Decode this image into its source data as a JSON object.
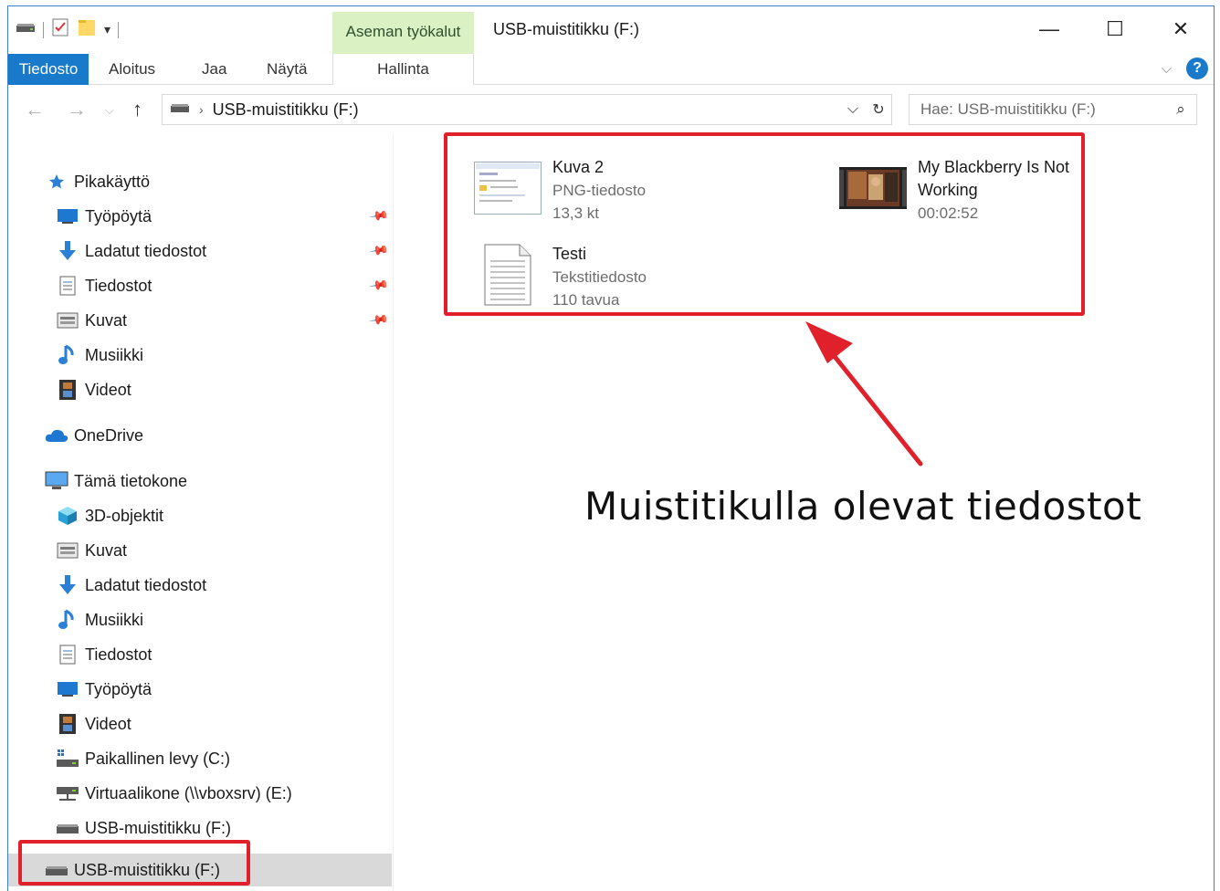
{
  "window": {
    "title": "USB-muistitikku (F:)",
    "context_tab_group": "Aseman työkalut",
    "caption_buttons": {
      "minimize": "—",
      "maximize": "☐",
      "close": "✕"
    }
  },
  "ribbon": {
    "tabs": [
      {
        "label": "Tiedosto"
      },
      {
        "label": "Aloitus"
      },
      {
        "label": "Jaa"
      },
      {
        "label": "Näytä"
      },
      {
        "label": "Hallinta"
      }
    ],
    "help_label": "?",
    "expand_icon": "chevron-down-icon"
  },
  "address": {
    "path": "USB-muistitikku (F:)",
    "search_placeholder": "Hae: USB-muistitikku (F:)"
  },
  "nav": {
    "quick_access": {
      "label": "Pikakäyttö",
      "items": [
        {
          "label": "Työpöytä",
          "icon": "desktop-icon",
          "pinned": true
        },
        {
          "label": "Ladatut tiedostot",
          "icon": "download-icon",
          "pinned": true
        },
        {
          "label": "Tiedostot",
          "icon": "documents-icon",
          "pinned": true
        },
        {
          "label": "Kuvat",
          "icon": "pictures-icon",
          "pinned": true
        },
        {
          "label": "Musiikki",
          "icon": "music-icon",
          "pinned": false
        },
        {
          "label": "Videot",
          "icon": "videos-icon",
          "pinned": false
        }
      ]
    },
    "onedrive": {
      "label": "OneDrive"
    },
    "this_pc": {
      "label": "Tämä tietokone",
      "items": [
        {
          "label": "3D-objektit",
          "icon": "3d-objects-icon"
        },
        {
          "label": "Kuvat",
          "icon": "pictures-icon"
        },
        {
          "label": "Ladatut tiedostot",
          "icon": "download-icon"
        },
        {
          "label": "Musiikki",
          "icon": "music-icon"
        },
        {
          "label": "Tiedostot",
          "icon": "documents-icon"
        },
        {
          "label": "Työpöytä",
          "icon": "desktop-icon"
        },
        {
          "label": "Videot",
          "icon": "videos-icon"
        },
        {
          "label": "Paikallinen levy (C:)",
          "icon": "local-disk-icon"
        },
        {
          "label": "Virtuaalikone (\\\\vboxsrv) (E:)",
          "icon": "network-drive-icon"
        },
        {
          "label": "USB-muistitikku (F:)",
          "icon": "usb-drive-icon"
        }
      ]
    },
    "usb_root": {
      "label": "USB-muistitikku (F:)",
      "selected": true
    }
  },
  "files": [
    {
      "name": "Kuva 2",
      "type": "PNG-tiedosto",
      "detail": "13,3 kt",
      "icon": "png-thumbnail-icon"
    },
    {
      "name": "My Blackberry Is Not",
      "name2": "Working",
      "detail": "00:02:52",
      "icon": "video-thumbnail-icon"
    },
    {
      "name": "Testi",
      "type": "Tekstitiedosto",
      "detail": "110 tavua",
      "icon": "text-file-icon"
    }
  ],
  "annotation": {
    "caption": "Muistitikulla olevat tiedostot",
    "color": "#e0202a"
  },
  "colors": {
    "accent": "#1979ca",
    "context_tab": "#d9f1c3",
    "selected": "#d9d9d9"
  }
}
